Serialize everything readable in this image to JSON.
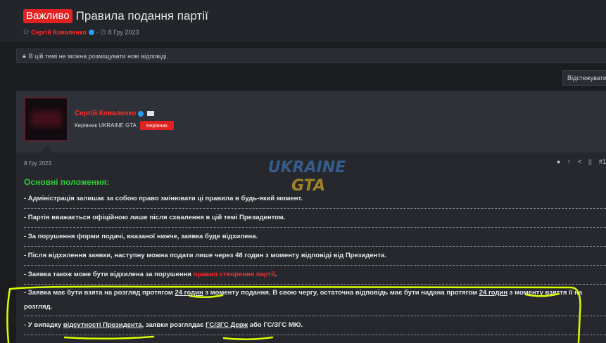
{
  "thread": {
    "badge": "Важливо",
    "title": "Правила подання партії",
    "author": "Сергій Коваленко",
    "date": "8 Гру 2023"
  },
  "notice": "В цій темі не можна розміщувати нові відповіді.",
  "follow_button": "Відстежувати",
  "post": {
    "author": "Сергій Коваленко",
    "user_title": "Керівник UKRAINE GTA",
    "role_badge": "Керівник",
    "date": "8 Гру 2023",
    "post_number": "#1",
    "watermark": [
      "UKRAINE",
      "GTA"
    ],
    "section_title": "Основні положення:",
    "rules": [
      {
        "text": "- Адміністрація залишає за собою право змінювати ці правила в будь-який момент."
      },
      {
        "text": "- Партія вважається офіційною лише після схвалення в цій темі Президентом."
      },
      {
        "text": "- За порушення форми подачі, вказаної нижче, заявка буде відхилена."
      },
      {
        "text": "- Після відхилення заявки, наступну можна подати лише через 48 годин з моменту відповіді від Президента."
      },
      {
        "pre": "- Заявка також може бути відхилена за порушення ",
        "link": "правил створення партії",
        "post": "."
      },
      {
        "p1": "- Заявка має бути взята на розгляд протягом ",
        "u1": "24 годин",
        "p2": " з моменту подання. В свою чергу, остаточна відповідь має бути надана протягом ",
        "u2": "24 годин",
        "p3": " з моменту взяття її на розгляд."
      },
      {
        "p1": "- У випадку ",
        "u1": "відсутності Президента",
        "p2": ", заявки розглядає ",
        "u2": "ГС/ЗГС Держ",
        "p3": " або ГС/ЗГС МЮ."
      }
    ]
  },
  "colors": {
    "accent_red": "#e12222",
    "section_green": "#2fca3a",
    "highlight_yellow": "#d8ff00"
  }
}
